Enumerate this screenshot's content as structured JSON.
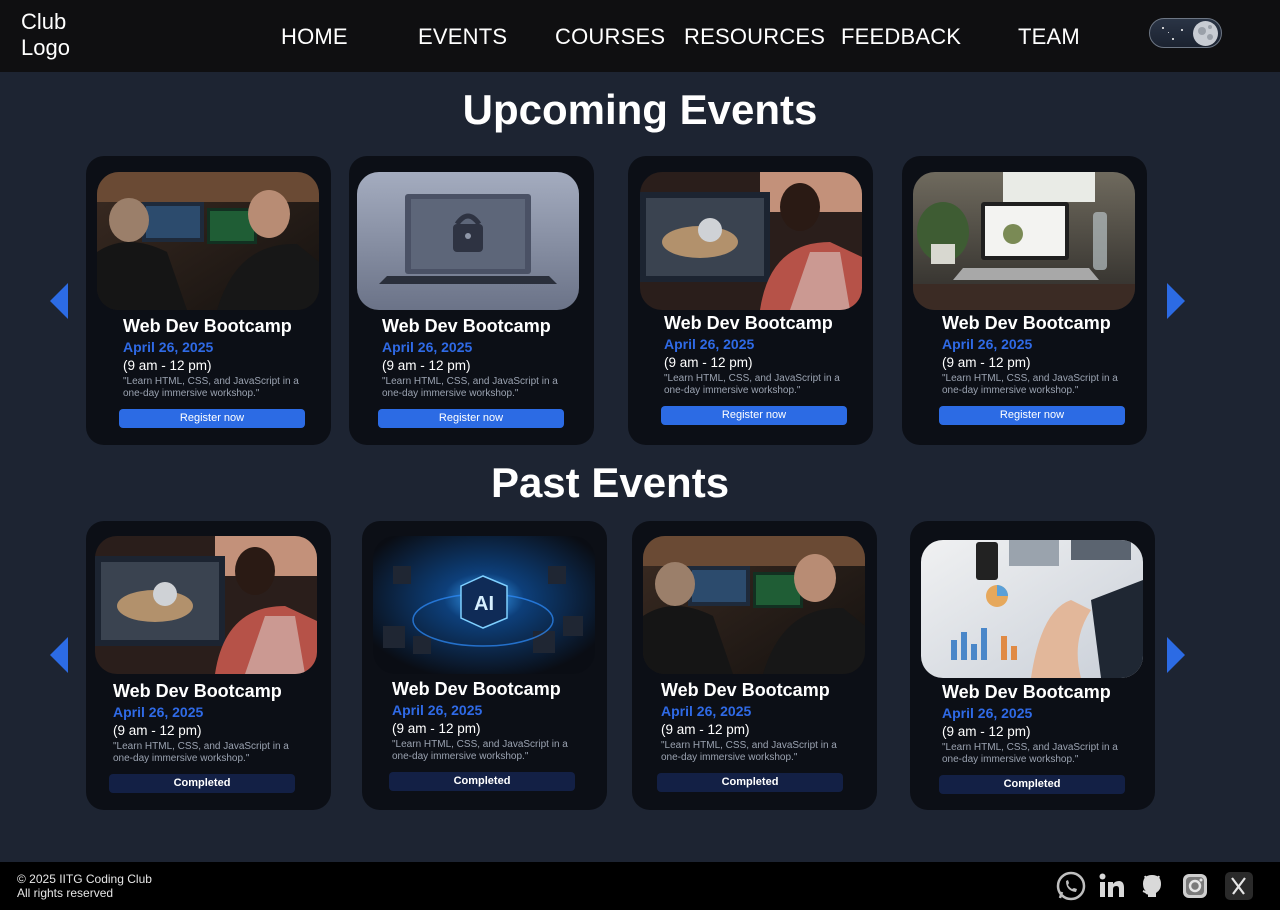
{
  "header": {
    "logo_line1": "Club",
    "logo_line2": "Logo",
    "nav": [
      "HOME",
      "EVENTS",
      "COURSES",
      "RESOURCES",
      "FEEDBACK",
      "TEAM"
    ]
  },
  "theme_toggle": {
    "state": "dark",
    "icon": "moon-icon"
  },
  "upcoming": {
    "title": "Upcoming Events",
    "events": [
      {
        "image": "two-developers-coding-photo",
        "title": "Web Dev Bootcamp",
        "date": "April 26, 2025",
        "time": "(9 am - 12 pm)",
        "description": "\"Learn HTML, CSS, and JavaScript in a one-day immersive workshop.\"",
        "button": "Register now"
      },
      {
        "image": "laptop-padlock-photo",
        "title": "Web Dev Bootcamp",
        "date": "April 26, 2025",
        "time": "(9 am - 12 pm)",
        "description": "\"Learn HTML, CSS, and JavaScript in a one-day immersive workshop.\"",
        "button": "Register now"
      },
      {
        "image": "developer-headphones-3d-photo",
        "title": "Web Dev Bootcamp",
        "date": "April 26, 2025",
        "time": "(9 am - 12 pm)",
        "description": "\"Learn HTML, CSS, and JavaScript in a one-day immersive workshop.\"",
        "button": "Register now"
      },
      {
        "image": "laptop-on-desk-photo",
        "title": "Web Dev Bootcamp",
        "date": "April 26, 2025",
        "time": "(9 am - 12 pm)",
        "description": "\"Learn HTML, CSS, and JavaScript in a one-day immersive workshop.\"",
        "button": "Register now"
      }
    ]
  },
  "past": {
    "title": "Past Events",
    "events": [
      {
        "image": "developer-headphones-3d-photo",
        "title": "Web Dev Bootcamp",
        "date": "April 26, 2025",
        "time": "(9 am - 12 pm)",
        "description": "\"Learn HTML, CSS, and JavaScript in a one-day immersive workshop.\"",
        "button": "Completed"
      },
      {
        "image": "ai-chip-photo",
        "title": "Web Dev Bootcamp",
        "date": "April 26, 2025",
        "time": "(9 am - 12 pm)",
        "description": "\"Learn HTML, CSS, and JavaScript in a one-day immersive workshop.\"",
        "button": "Completed"
      },
      {
        "image": "two-developers-coding-photo",
        "title": "Web Dev Bootcamp",
        "date": "April 26, 2025",
        "time": "(9 am - 12 pm)",
        "description": "\"Learn HTML, CSS, and JavaScript in a one-day immersive workshop.\"",
        "button": "Completed"
      },
      {
        "image": "business-charts-photo",
        "title": "Web Dev Bootcamp",
        "date": "April 26, 2025",
        "time": "(9 am - 12 pm)",
        "description": "\"Learn HTML, CSS, and JavaScript in a one-day immersive workshop.\"",
        "button": "Completed"
      }
    ]
  },
  "footer": {
    "copyright": "© 2025 IITG Coding Club",
    "rights": "All rights reserved",
    "social": [
      "whatsapp-icon",
      "linkedin-icon",
      "github-icon",
      "instagram-icon",
      "x-twitter-icon"
    ]
  },
  "colors": {
    "background": "#1d2432",
    "header": "#0f0f11",
    "card": "#0c0f16",
    "accent": "#2c6be4",
    "date": "#2f6ae6",
    "completed": "#132045"
  }
}
